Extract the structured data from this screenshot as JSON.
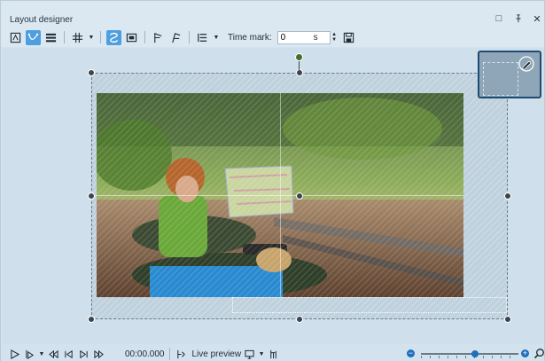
{
  "window": {
    "title": "Layout designer",
    "controls": {
      "minimize": "□",
      "pin": "⫯",
      "close": "✕"
    }
  },
  "toolbar": {
    "icons": [
      "snapshot-icon",
      "curve-select-icon",
      "lines-icon",
      "grid-icon",
      "dropdown-arrow-icon",
      "animation-path-icon",
      "fit-frame-icon",
      "align-left-icon",
      "align-right-icon",
      "list-icon",
      "dropdown-arrow-icon"
    ],
    "time_mark_label": "Time mark:",
    "time_mark_value": "0",
    "time_mark_unit": "s",
    "save_icon": "save-icon"
  },
  "canvas": {
    "accent_color": "#4d9fe0",
    "preview_icon": "edit-pen-icon"
  },
  "bottom": {
    "time": "00:00.000",
    "live_preview_label": "Live preview",
    "zoom_level": 0.55
  }
}
